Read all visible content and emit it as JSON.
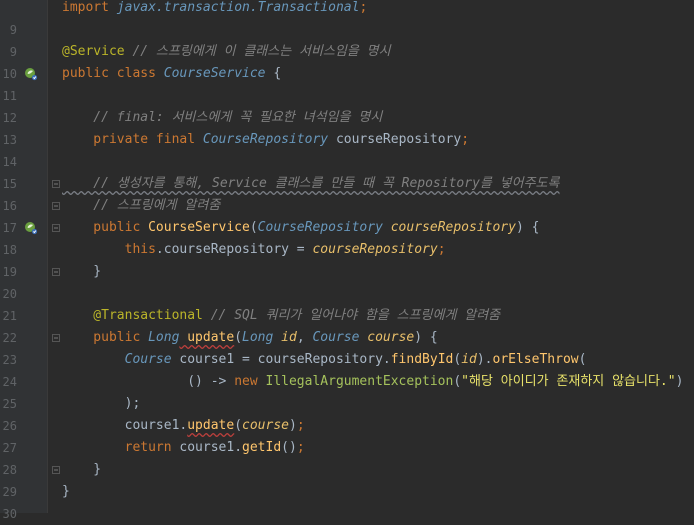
{
  "editor": {
    "lines": [
      {
        "n": "",
        "segments": [
          {
            "cls": "t-kw",
            "text": "import "
          },
          {
            "cls": "t-pkg",
            "text": "javax.transaction.Transactional"
          },
          {
            "cls": "t-semi",
            "text": ";"
          }
        ]
      },
      {
        "n": "9",
        "segments": []
      },
      {
        "n": "9",
        "segments": [
          {
            "cls": "t-ann",
            "text": "@Service"
          },
          {
            "cls": "t-cmt",
            "text": " // 스프링에게 이 클래스는 서비스임을 명시"
          }
        ]
      },
      {
        "n": "10",
        "mark": "bean",
        "segments": [
          {
            "cls": "t-kw",
            "text": "public class "
          },
          {
            "cls": "t-cls",
            "text": "CourseService"
          },
          {
            "cls": "t-plain",
            "text": " {"
          }
        ]
      },
      {
        "n": "11",
        "segments": []
      },
      {
        "n": "12",
        "segments": [
          {
            "cls": "t-cmt",
            "text": "    // final: 서비스에게 꼭 필요한 녀석임을 명시"
          }
        ]
      },
      {
        "n": "13",
        "segments": [
          {
            "cls": "t-kw",
            "text": "    private final "
          },
          {
            "cls": "t-cls",
            "text": "CourseRepository"
          },
          {
            "cls": "t-plain",
            "text": " courseRepository"
          },
          {
            "cls": "t-semi",
            "text": ";"
          }
        ]
      },
      {
        "n": "14",
        "segments": []
      },
      {
        "n": "15",
        "fold": true,
        "segments": [
          {
            "cls": "t-cmt",
            "text": "    // 생성자를 통해, Service 클래스를 만들 때 꼭 Repository를 넣어주도록"
          }
        ]
      },
      {
        "n": "16",
        "fold": true,
        "segments": [
          {
            "cls": "t-cmt",
            "text": "    // 스프링에게 알려줌"
          }
        ]
      },
      {
        "n": "17",
        "mark": "bean",
        "fold": true,
        "segments": [
          {
            "cls": "t-kw",
            "text": "    public "
          },
          {
            "cls": "t-fn",
            "text": "CourseService"
          },
          {
            "cls": "t-plain",
            "text": "("
          },
          {
            "cls": "t-cls",
            "text": "CourseRepository"
          },
          {
            "cls": "t-param",
            "text": " courseRepository"
          },
          {
            "cls": "t-plain",
            "text": ") {"
          }
        ]
      },
      {
        "n": "18",
        "segments": [
          {
            "cls": "t-kw",
            "text": "        this"
          },
          {
            "cls": "t-plain",
            "text": ".courseRepository = "
          },
          {
            "cls": "t-param",
            "text": "courseRepository"
          },
          {
            "cls": "t-semi",
            "text": ";"
          }
        ]
      },
      {
        "n": "19",
        "fold": true,
        "segments": [
          {
            "cls": "t-plain",
            "text": "    }"
          }
        ]
      },
      {
        "n": "20",
        "segments": []
      },
      {
        "n": "21",
        "segments": [
          {
            "cls": "t-ann",
            "text": "    @Transactional"
          },
          {
            "cls": "t-cmt",
            "text": " // SQL 쿼리가 일어나야 함을 스프링에게 알려줌"
          }
        ]
      },
      {
        "n": "22",
        "fold": true,
        "segments": [
          {
            "cls": "t-kw",
            "text": "    public "
          },
          {
            "cls": "t-cls",
            "text": "Long"
          },
          {
            "cls": "t-fn",
            "text": " update"
          },
          {
            "cls": "t-plain",
            "text": "("
          },
          {
            "cls": "t-cls",
            "text": "Long"
          },
          {
            "cls": "t-param",
            "text": " id"
          },
          {
            "cls": "t-plain",
            "text": ", "
          },
          {
            "cls": "t-cls",
            "text": "Course"
          },
          {
            "cls": "t-param",
            "text": " course"
          },
          {
            "cls": "t-plain",
            "text": ") {"
          }
        ]
      },
      {
        "n": "23",
        "segments": [
          {
            "cls": "t-cls",
            "text": "        Course"
          },
          {
            "cls": "t-plain",
            "text": " course1 = courseRepository."
          },
          {
            "cls": "t-fn",
            "text": "findById"
          },
          {
            "cls": "t-plain",
            "text": "("
          },
          {
            "cls": "t-param",
            "text": "id"
          },
          {
            "cls": "t-plain",
            "text": ")."
          },
          {
            "cls": "t-fn",
            "text": "orElseThrow"
          },
          {
            "cls": "t-plain",
            "text": "("
          }
        ]
      },
      {
        "n": "24",
        "segments": [
          {
            "cls": "t-plain",
            "text": "                () -> "
          },
          {
            "cls": "t-kw",
            "text": "new "
          },
          {
            "cls": "t-green",
            "text": "IllegalArgumentException"
          },
          {
            "cls": "t-plain",
            "text": "("
          },
          {
            "cls": "t-yellow",
            "text": "\"해당 아이디가 존재하지 않습니다.\""
          },
          {
            "cls": "t-plain",
            "text": ")"
          }
        ]
      },
      {
        "n": "25",
        "segments": [
          {
            "cls": "t-plain",
            "text": "        );"
          }
        ]
      },
      {
        "n": "26",
        "segments": [
          {
            "cls": "t-plain",
            "text": "        course1."
          },
          {
            "cls": "t-fn",
            "text": "update"
          },
          {
            "cls": "t-plain",
            "text": "("
          },
          {
            "cls": "t-param",
            "text": "course"
          },
          {
            "cls": "t-plain",
            "text": ")"
          },
          {
            "cls": "t-semi",
            "text": ";"
          }
        ]
      },
      {
        "n": "27",
        "segments": [
          {
            "cls": "t-kw",
            "text": "        return "
          },
          {
            "cls": "t-plain",
            "text": "course1."
          },
          {
            "cls": "t-fn",
            "text": "getId"
          },
          {
            "cls": "t-plain",
            "text": "()"
          },
          {
            "cls": "t-semi",
            "text": ";"
          }
        ]
      },
      {
        "n": "28",
        "fold": true,
        "segments": [
          {
            "cls": "t-plain",
            "text": "    }"
          }
        ]
      },
      {
        "n": "29",
        "segments": [
          {
            "cls": "t-plain",
            "text": "}"
          }
        ]
      },
      {
        "n": "30",
        "segments": []
      }
    ]
  },
  "colors": {
    "background": "#2b2b2b",
    "gutter": "#313335",
    "keyword": "#cc7832",
    "annotation": "#bbb529",
    "comment": "#808080",
    "class": "#6897bb",
    "method": "#ffc66d",
    "parameter": "#e8bf6a"
  },
  "icons": {
    "bean": "spring-bean-icon",
    "fold": "fold-marker-icon"
  }
}
